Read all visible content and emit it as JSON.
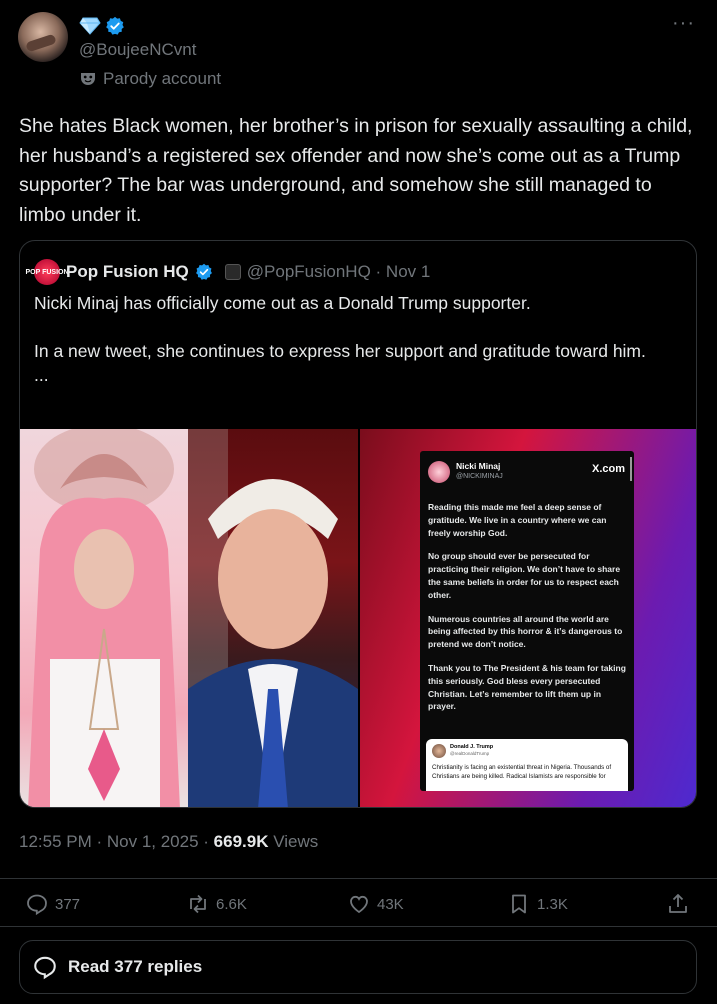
{
  "author": {
    "handle": "@BoujeeNCvnt",
    "label": "Parody account"
  },
  "more_icon": "···",
  "tweet": {
    "text": "She hates Black women, her brother’s in prison for sexually assaulting a child, her husband’s a registered sex offender and now she’s come out as a Trump supporter? The bar was underground, and somehow she still managed to limbo under it."
  },
  "quote": {
    "name": "Pop Fusion HQ",
    "handle_date": "@PopFusionHQ · Nov 1",
    "avatar_text": "POP FUSION",
    "line1": "Nicki Minaj has officially come out as a Donald Trump supporter.",
    "line2": "In a new tweet, she continues to express her support and gratitude toward him.",
    "line3": "...",
    "embedded_post": {
      "name": "Nicki Minaj",
      "handle": "@NICKIMINAJ",
      "site": "X.com",
      "p1": "Reading this made me feel a deep sense of gratitude. We live in a country where we can freely worship God.",
      "p2": "No group should ever be persecuted for practicing their religion. We don’t have to share the same beliefs in order for us to respect each other.",
      "p3": "Numerous countries all around the world are being affected by this horror & it’s dangerous to pretend we don’t notice.",
      "p4": "Thank you to The President & his team for taking this seriously. God bless every persecuted Christian. Let’s remember to lift them up in prayer.",
      "card_name": "Donald J. Trump",
      "card_handle": "@realDonaldTrump",
      "card_text": "Christianity is facing an existential threat in Nigeria. Thousands of Christians are being killed. Radical Islamists are responsible for"
    }
  },
  "meta": {
    "time": "12:55 PM · Nov 1, 2025 · ",
    "views_count": "669.9K",
    "views_label": " Views"
  },
  "actions": {
    "replies": "377",
    "reposts": "6.6K",
    "likes": "43K",
    "bookmarks": "1.3K"
  },
  "read_replies": "Read 377 replies",
  "colors": {
    "background": "#000000",
    "text": "#e7e9ea",
    "muted": "#71767b",
    "border": "#2f3336",
    "verified": "#1d9bf0"
  }
}
